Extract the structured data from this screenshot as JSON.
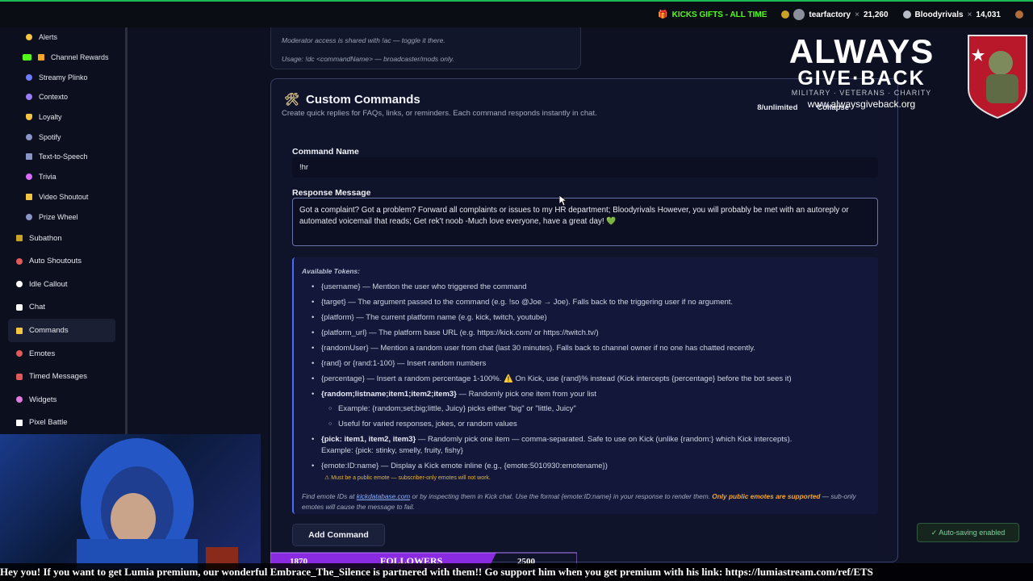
{
  "topbar": {
    "gifts_label": "KICKS GIFTS - ALL TIME",
    "leaders": [
      {
        "name": "tearfactory",
        "count": "21,260"
      },
      {
        "name": "Bloodyrivals",
        "count": "14,031"
      }
    ]
  },
  "sidebar": {
    "sub_items": [
      {
        "label": "Alerts",
        "icon": "bell-icon",
        "color": "#f5c542"
      },
      {
        "label": "Channel Rewards",
        "icon": "gift-icon",
        "color": "#53fc18"
      },
      {
        "label": "Streamy Plinko",
        "icon": "dot-icon",
        "color": "#6f7cff"
      },
      {
        "label": "Contexto",
        "icon": "dot-icon",
        "color": "#9b7cff"
      },
      {
        "label": "Loyalty",
        "icon": "shield-icon",
        "color": "#f5c542"
      },
      {
        "label": "Spotify",
        "icon": "music-icon",
        "color": "#8a94c9"
      },
      {
        "label": "Text-to-Speech",
        "icon": "speaker-icon",
        "color": "#8a94c9"
      },
      {
        "label": "Trivia",
        "icon": "dot-icon",
        "color": "#d96cff"
      },
      {
        "label": "Video Shoutout",
        "icon": "video-icon",
        "color": "#f5c542"
      },
      {
        "label": "Prize Wheel",
        "icon": "wheel-icon",
        "color": "#8a94c9"
      }
    ],
    "top_items": [
      {
        "label": "Subathon",
        "icon": "hourglass-icon",
        "color": "#c9a227"
      },
      {
        "label": "Auto Shoutouts",
        "icon": "rocket-icon",
        "color": "#e05a5a"
      },
      {
        "label": "Idle Callout",
        "icon": "clock-icon",
        "color": "#ffffff"
      },
      {
        "label": "Chat",
        "icon": "chat-icon",
        "color": "#ffffff"
      },
      {
        "label": "Commands",
        "icon": "bolt-icon",
        "color": "#f5c542"
      },
      {
        "label": "Emotes",
        "icon": "smile-icon",
        "color": "#e05a5a"
      },
      {
        "label": "Timed Messages",
        "icon": "timer-icon",
        "color": "#e05a5a"
      },
      {
        "label": "Widgets",
        "icon": "palette-icon",
        "color": "#e07adf"
      },
      {
        "label": "Pixel Battle",
        "icon": "swords-icon",
        "color": "#ffffff"
      }
    ]
  },
  "prev_card": {
    "line1": "Moderator access is shared with !ac — toggle it there.",
    "line2": "Usage: !dc <commandName> — broadcaster/mods only."
  },
  "card": {
    "title": "Custom Commands",
    "subtitle": "Create quick replies for FAQs, links, or reminders. Each command responds instantly in chat.",
    "count": "8/unlimited",
    "collapse": "Collapse",
    "name_label": "Command Name",
    "name_value": "!hr",
    "message_label": "Response Message",
    "message_value": "Got a complaint?  Got a problem? Forward all complaints or issues to my HR department; Bloodyrivals However, you will probably be met with an autoreply or automated voicemail that reads; Get rek't noob -Much love everyone, have a great day! 💚",
    "tokens_heading": "Available Tokens:",
    "tokens": {
      "t1": "{username} — Mention the user who triggered the command",
      "t2": "{target} — The argument passed to the command (e.g. !so @Joe → Joe). Falls back to the triggering user if no argument.",
      "t3": "{platform} — The current platform name (e.g. kick, twitch, youtube)",
      "t4": "{platform_url} — The platform base URL (e.g. https://kick.com/ or https://twitch.tv/)",
      "t5": "{randomUser} — Mention a random user from chat (last 30 minutes). Falls back to channel owner if no one has chatted recently.",
      "t6": "{rand} or {rand:1-100} — Insert random numbers",
      "t7": "{percentage} — Insert a random percentage 1-100%. ⚠️ On Kick, use {rand}% instead (Kick intercepts {percentage} before the bot sees it)",
      "t8_bold": "{random;listname;item1;item2;item3}",
      "t8_rest": " — Randomly pick one item from your list",
      "t8_sub1": "Example: {random;set;big;little, Juicy} picks either \"big\" or \"little, Juicy\"",
      "t8_sub2": "Useful for varied responses, jokes, or random values",
      "t9_bold": "{pick: item1, item2, item3}",
      "t9_rest": " — Randomly pick one item — comma-separated. Safe to use on Kick (unlike {random:} which Kick intercepts).",
      "t9_cont": "Example: {pick: stinky, smelly, fruity, fishy}",
      "t10": "{emote:ID:name} — Display a Kick emote inline (e.g., {emote:5010930:emotename})",
      "t10_warn": "Must be a public emote — subscriber-only emotes will not work."
    },
    "footnote_a": "Find emote IDs at ",
    "footnote_link": "kickdatabase.com",
    "footnote_b": " or by inspecting them in Kick chat. Use the format {emote:ID:name} in your response to render them. ",
    "footnote_bold": "Only public emotes are supported",
    "footnote_c": " — sub-only emotes will cause the message to fail.",
    "add_button": "Add Command"
  },
  "autosave": "✓ Auto-saving enabled",
  "overlay": {
    "logo_line1": "ALWAYS",
    "logo_line2": "GIVE·BACK",
    "logo_line3": "MILITARY · VETERANS · CHARITY",
    "logo_url": "www.alwaysgiveback.org",
    "followers_left": "1870",
    "followers_label": "FOLLOWERS",
    "followers_right": "2500",
    "ticker": "Hey you! If you want to get Lumia premium, our wonderful Embrace_The_Silence is partnered with them!! Go support him when you get premium with his link: https://lumiastream.com/ref/ETS"
  }
}
